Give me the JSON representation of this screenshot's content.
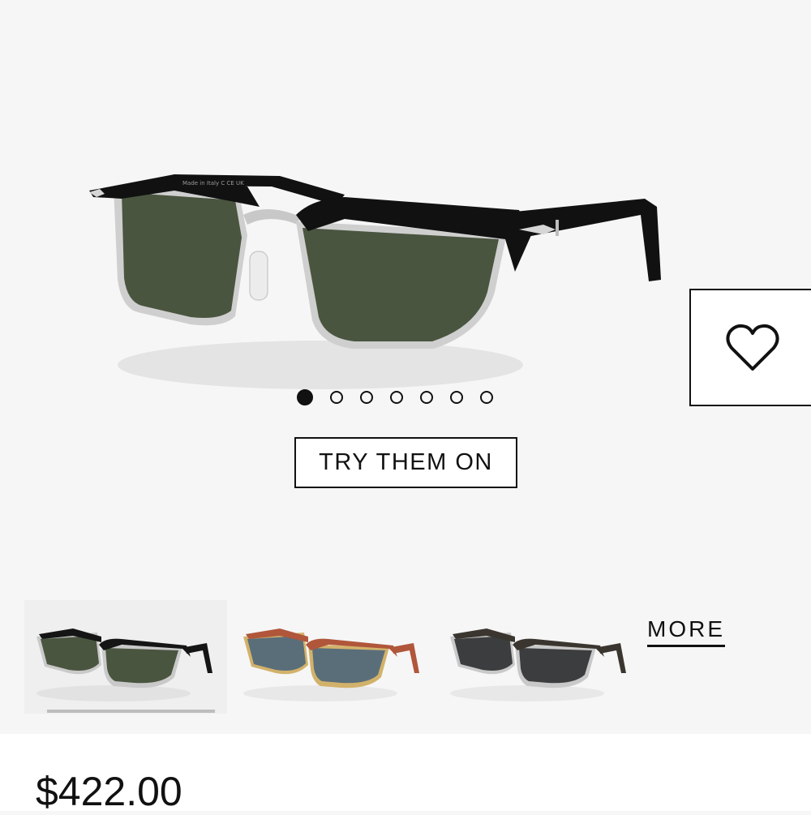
{
  "product": {
    "image_name": "black-silver-browline-sunglasses",
    "lens_color": "#4a5540",
    "frame_color": "#111111",
    "metal_color": "#c8c8c8",
    "temple_text": "Made in Italy  C  CE UK",
    "price": "$422.00"
  },
  "carousel": {
    "dot_count": 7,
    "active_index": 0
  },
  "actions": {
    "try_on_label": "TRY THEM ON",
    "wishlist_icon": "heart-icon"
  },
  "variants": {
    "items": [
      {
        "name": "black-green-variant",
        "frame_color": "#151515",
        "lens_color": "#4a5540",
        "metal_color": "#c9c9c9"
      },
      {
        "name": "havana-blue-variant",
        "frame_color": "#b0563b",
        "lens_color": "#5a6e7a",
        "metal_color": "#d2b26a"
      },
      {
        "name": "tortoise-grey-variant",
        "frame_color": "#3a362f",
        "lens_color": "#3c3d3e",
        "metal_color": "#c9c9c9"
      }
    ],
    "more_label": "MORE",
    "selected_index": 0
  }
}
